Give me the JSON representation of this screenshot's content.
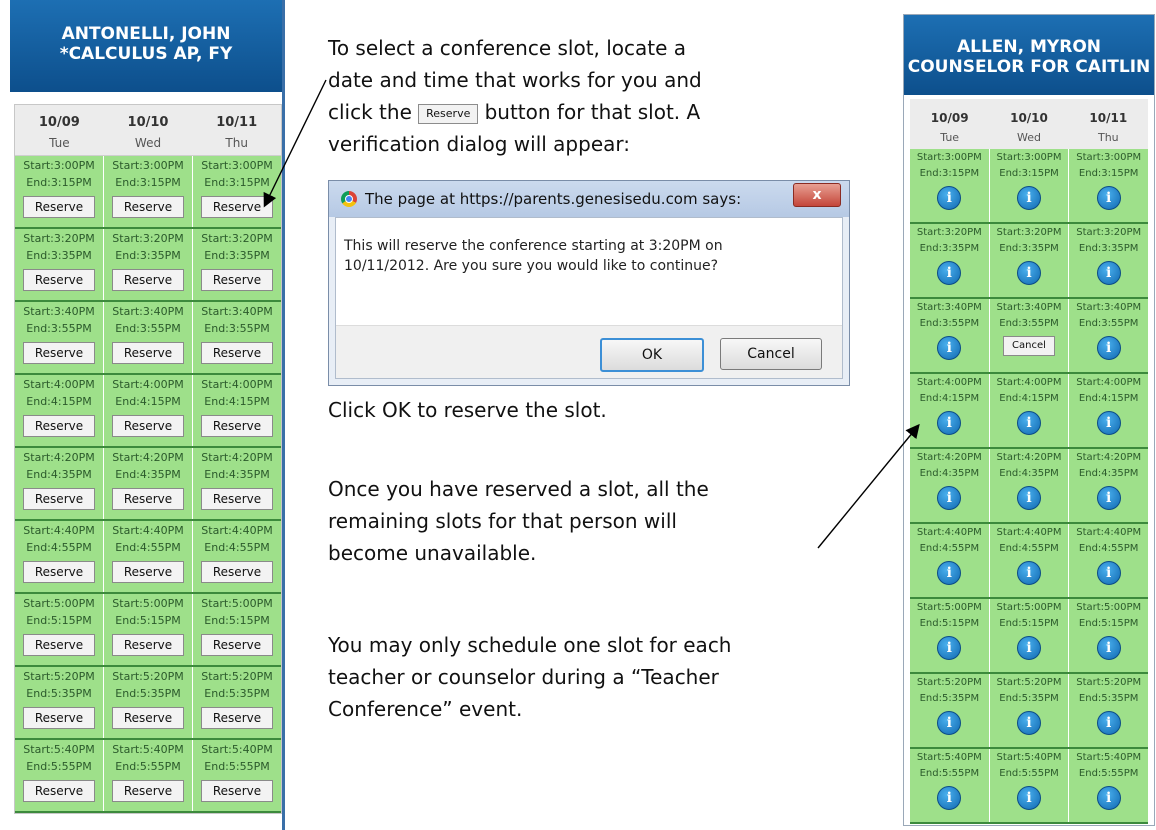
{
  "left_panel": {
    "header_line1": "ANTONELLI, JOHN",
    "header_line2": "*CALCULUS AP, FY",
    "dates": [
      {
        "date": "10/09",
        "weekday": "Tue"
      },
      {
        "date": "10/10",
        "weekday": "Wed"
      },
      {
        "date": "10/11",
        "weekday": "Thu"
      }
    ],
    "reserve_label": "Reserve",
    "slots": [
      {
        "start": "Start:3:00PM",
        "end": "End:3:15PM"
      },
      {
        "start": "Start:3:20PM",
        "end": "End:3:35PM"
      },
      {
        "start": "Start:3:40PM",
        "end": "End:3:55PM"
      },
      {
        "start": "Start:4:00PM",
        "end": "End:4:15PM"
      },
      {
        "start": "Start:4:20PM",
        "end": "End:4:35PM"
      },
      {
        "start": "Start:4:40PM",
        "end": "End:4:55PM"
      },
      {
        "start": "Start:5:00PM",
        "end": "End:5:15PM"
      },
      {
        "start": "Start:5:20PM",
        "end": "End:5:35PM"
      },
      {
        "start": "Start:5:40PM",
        "end": "End:5:55PM"
      }
    ]
  },
  "instructions": {
    "line1": "To select a conference slot, locate a",
    "line2": "date and time that works for you and",
    "line3_before": "click the",
    "inline_button": "Reserve",
    "line3_after": "button for that slot.  A",
    "line4": "verification dialog will appear:",
    "click_ok": "Click OK to reserve the slot.",
    "para2_line1": "Once you have reserved a slot, all the",
    "para2_line2": "remaining slots for that person will",
    "para2_line3": "become unavailable.",
    "para3_line1": "You may only schedule one slot for each",
    "para3_line2": "teacher or counselor during a “Teacher",
    "para3_line3": "Conference” event."
  },
  "dialog": {
    "title": "The page at https://parents.genesisedu.com says:",
    "close_label": "x",
    "message_line1": "This will reserve the conference starting at 3:20PM on",
    "message_line2": "10/11/2012.  Are you sure you would like to continue?",
    "ok_label": "OK",
    "cancel_label": "Cancel"
  },
  "right_panel": {
    "header_line1": "ALLEN, MYRON",
    "header_line2": "COUNSELOR FOR CAITLIN",
    "dates": [
      {
        "date": "10/09",
        "weekday": "Tue"
      },
      {
        "date": "10/10",
        "weekday": "Wed"
      },
      {
        "date": "10/11",
        "weekday": "Thu"
      }
    ],
    "info_glyph": "i",
    "cancel_label": "Cancel",
    "slots": [
      {
        "start": "Start:3:00PM",
        "end": "End:3:15PM"
      },
      {
        "start": "Start:3:20PM",
        "end": "End:3:35PM"
      },
      {
        "start": "Start:3:40PM",
        "end": "End:3:55PM"
      },
      {
        "start": "Start:4:00PM",
        "end": "End:4:15PM"
      },
      {
        "start": "Start:4:20PM",
        "end": "End:4:35PM"
      },
      {
        "start": "Start:4:40PM",
        "end": "End:4:55PM"
      },
      {
        "start": "Start:5:00PM",
        "end": "End:5:15PM"
      },
      {
        "start": "Start:5:20PM",
        "end": "End:5:35PM"
      },
      {
        "start": "Start:5:40PM",
        "end": "End:5:55PM"
      }
    ],
    "reserved_cell": {
      "slot": 2,
      "day": 1
    }
  },
  "colors": {
    "header_blue": "#0d4f8c",
    "slot_green": "#9ee08a",
    "slot_border": "#3c8a3c"
  }
}
